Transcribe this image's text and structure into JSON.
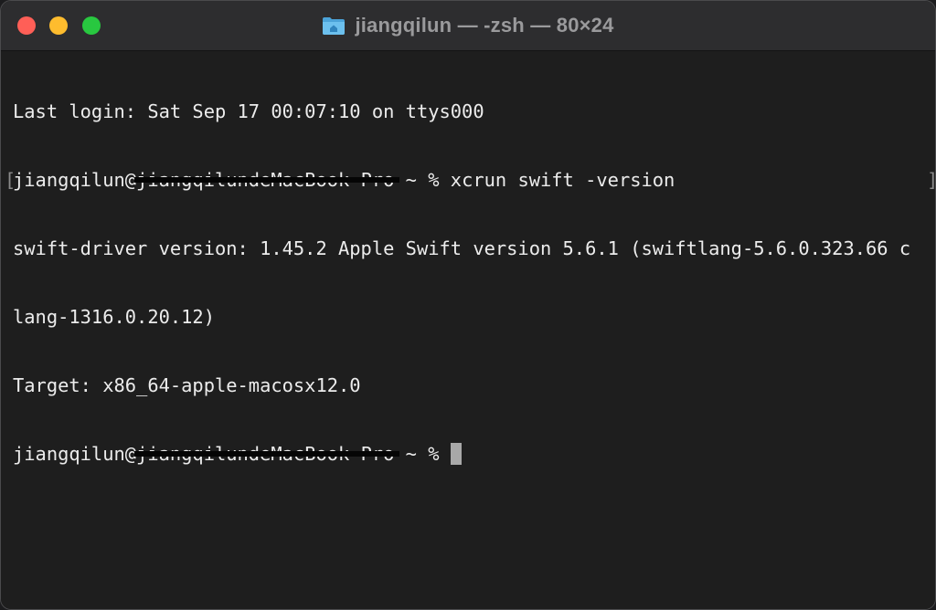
{
  "window": {
    "title": "jiangqilun — -zsh — 80×24",
    "title_icon": "folder-home-icon",
    "controls": [
      "close",
      "minimize",
      "zoom"
    ],
    "colors": {
      "close": "#ff5f57",
      "minimize": "#febc2e",
      "zoom": "#28c840",
      "background": "#1e1e1e",
      "text": "#ececec"
    }
  },
  "terminal": {
    "last_login": "Last login: Sat Sep 17 00:07:10 on ttys000",
    "prompt1_user": "jiangqilun@",
    "prompt1_host": "jiangqilundeMacBook-Pro",
    "prompt1_rest": " ~ % ",
    "command": "xcrun swift -version",
    "output1": "swift-driver version: 1.45.2 Apple Swift version 5.6.1 (swiftlang-5.6.0.323.66 c",
    "output2": "lang-1316.0.20.12)",
    "output3": "Target: x86_64-apple-macosx12.0",
    "prompt2_user": "jiangqilun@",
    "prompt2_host": "jiangqilundeMacBook-Pro",
    "prompt2_rest": " ~ % ",
    "mark_left": "[",
    "mark_right": "]"
  }
}
